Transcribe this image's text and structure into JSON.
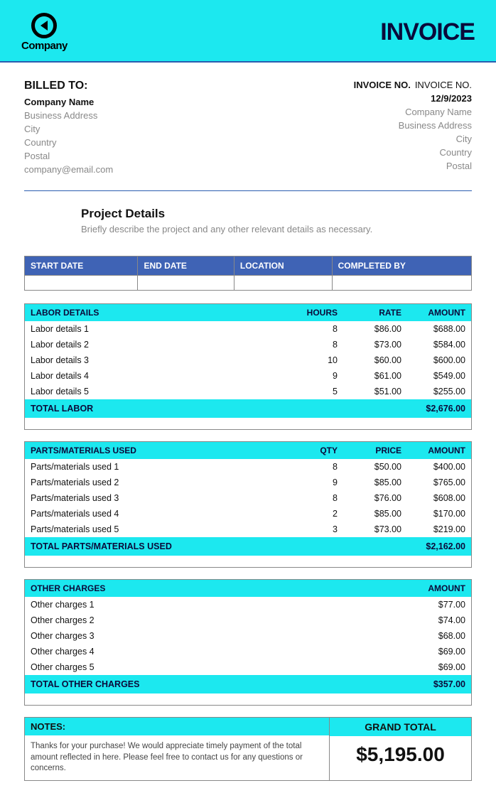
{
  "header": {
    "company_label": "Company",
    "title": "INVOICE"
  },
  "billed": {
    "title": "BILLED TO:",
    "name": "Company Name",
    "address": "Business Address",
    "city": "City",
    "country": "Country",
    "postal": "Postal",
    "email": "company@email.com"
  },
  "invoice_info": {
    "no_label": "INVOICE NO.",
    "no_value": "INVOICE NO.",
    "date": "12/9/2023",
    "company": "Company Name",
    "address": "Business Address",
    "city": "City",
    "country": "Country",
    "postal": "Postal"
  },
  "project": {
    "title": "Project Details",
    "desc": "Briefly describe the project and any other relevant details as necessary."
  },
  "meta_headers": {
    "start": "START DATE",
    "end": "END DATE",
    "location": "LOCATION",
    "completed": "COMPLETED BY"
  },
  "labor": {
    "headers": {
      "details": "LABOR DETAILS",
      "hours": "HOURS",
      "rate": "RATE",
      "amount": "AMOUNT"
    },
    "rows": [
      {
        "label": "Labor details 1",
        "hours": "8",
        "rate": "$86.00",
        "amount": "$688.00"
      },
      {
        "label": "Labor details 2",
        "hours": "8",
        "rate": "$73.00",
        "amount": "$584.00"
      },
      {
        "label": "Labor details 3",
        "hours": "10",
        "rate": "$60.00",
        "amount": "$600.00"
      },
      {
        "label": "Labor details 4",
        "hours": "9",
        "rate": "$61.00",
        "amount": "$549.00"
      },
      {
        "label": "Labor details 5",
        "hours": "5",
        "rate": "$51.00",
        "amount": "$255.00"
      }
    ],
    "total_label": "TOTAL LABOR",
    "total_value": "$2,676.00"
  },
  "parts": {
    "headers": {
      "details": "PARTS/MATERIALS USED",
      "qty": "QTY",
      "price": "PRICE",
      "amount": "AMOUNT"
    },
    "rows": [
      {
        "label": "Parts/materials used 1",
        "qty": "8",
        "price": "$50.00",
        "amount": "$400.00"
      },
      {
        "label": "Parts/materials used 2",
        "qty": "9",
        "price": "$85.00",
        "amount": "$765.00"
      },
      {
        "label": "Parts/materials used 3",
        "qty": "8",
        "price": "$76.00",
        "amount": "$608.00"
      },
      {
        "label": "Parts/materials used 4",
        "qty": "2",
        "price": "$85.00",
        "amount": "$170.00"
      },
      {
        "label": "Parts/materials used 5",
        "qty": "3",
        "price": "$73.00",
        "amount": "$219.00"
      }
    ],
    "total_label": "TOTAL PARTS/MATERIALS USED",
    "total_value": "$2,162.00"
  },
  "other": {
    "headers": {
      "details": "OTHER CHARGES",
      "amount": "AMOUNT"
    },
    "rows": [
      {
        "label": "Other charges 1",
        "amount": "$77.00"
      },
      {
        "label": "Other charges 2",
        "amount": "$74.00"
      },
      {
        "label": "Other charges 3",
        "amount": "$68.00"
      },
      {
        "label": "Other charges 4",
        "amount": "$69.00"
      },
      {
        "label": "Other charges 5",
        "amount": "$69.00"
      }
    ],
    "total_label": "TOTAL OTHER CHARGES",
    "total_value": "$357.00"
  },
  "footer": {
    "notes_label": "NOTES:",
    "notes_body": "Thanks for your purchase! We would appreciate timely payment of the total amount reflected in here. Please feel free to contact us for any questions or concerns.",
    "grand_label": "GRAND TOTAL",
    "grand_value": "$5,195.00"
  }
}
